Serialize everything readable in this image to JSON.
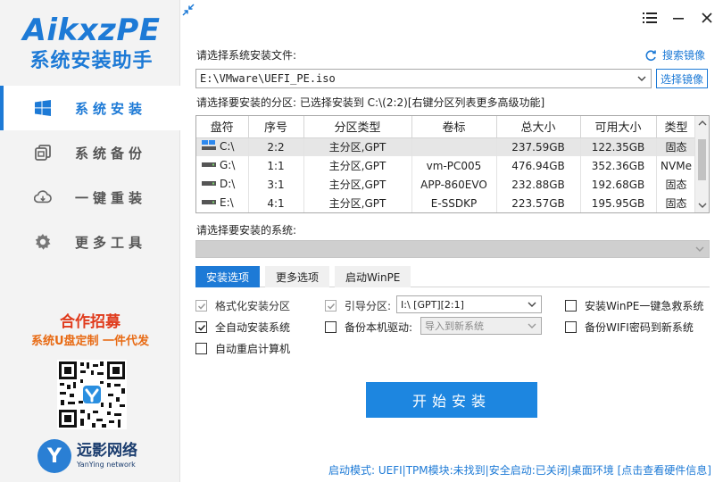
{
  "app": {
    "logo_en": "AikxzPE",
    "logo_cn": "系统安装助手"
  },
  "nav": [
    {
      "label": "系统安装",
      "icon": "windows-icon",
      "active": true
    },
    {
      "label": "系统备份",
      "icon": "backup-icon",
      "active": false
    },
    {
      "label": "一键重装",
      "icon": "cloud-icon",
      "active": false
    },
    {
      "label": "更多工具",
      "icon": "gear-icon",
      "active": false
    }
  ],
  "promo": {
    "title": "合作招募",
    "subtitle": "系统U盘定制 一件代发"
  },
  "brand": {
    "name_cn": "远影网络",
    "name_en": "YanYing network"
  },
  "image_section": {
    "label": "请选择系统安装文件:",
    "path": "E:\\VMware\\UEFI_PE.iso",
    "search_link": "搜索镜像",
    "browse_button": "选择镜像"
  },
  "partition_section": {
    "label": "请选择要安装的分区: 已选择安装到 C:\\(2:2)[右键分区列表更多高级功能]",
    "columns": [
      "盘符",
      "序号",
      "分区类型",
      "卷标",
      "总大小",
      "可用大小",
      "类型"
    ],
    "rows": [
      {
        "drive": "C:\\",
        "index": "2:2",
        "ptype": "主分区,GPT",
        "label": "",
        "total": "237.59GB",
        "free": "122.35GB",
        "kind": "固态",
        "selected": true,
        "icon": "windows-drive-icon"
      },
      {
        "drive": "G:\\",
        "index": "1:1",
        "ptype": "主分区,GPT",
        "label": "vm-PC005",
        "total": "476.94GB",
        "free": "352.36GB",
        "kind": "NVMe",
        "selected": false,
        "icon": "drive-icon"
      },
      {
        "drive": "D:\\",
        "index": "3:1",
        "ptype": "主分区,GPT",
        "label": "APP-860EVO",
        "total": "232.88GB",
        "free": "192.68GB",
        "kind": "固态",
        "selected": false,
        "icon": "drive-icon"
      },
      {
        "drive": "E:\\",
        "index": "4:1",
        "ptype": "主分区,GPT",
        "label": "E-SSDKP",
        "total": "223.57GB",
        "free": "195.95GB",
        "kind": "固态",
        "selected": false,
        "icon": "drive-icon"
      }
    ]
  },
  "system_section": {
    "label": "请选择要安装的系统:"
  },
  "tabs": [
    {
      "label": "安装选项",
      "active": true
    },
    {
      "label": "更多选项",
      "active": false
    },
    {
      "label": "启动WinPE",
      "active": false
    }
  ],
  "options": {
    "format_partition": {
      "label": "格式化安装分区",
      "checked": true,
      "disabled": true
    },
    "auto_install": {
      "label": "全自动安装系统",
      "checked": true,
      "disabled": false
    },
    "auto_restart": {
      "label": "自动重启计算机",
      "checked": false,
      "disabled": false
    },
    "boot_partition": {
      "label": "引导分区:",
      "checked": true,
      "disabled": true,
      "value": "I:\\ [GPT][2:1]"
    },
    "backup_driver": {
      "label": "备份本机驱动:",
      "checked": false,
      "disabled": false,
      "value": "导入到新系统"
    },
    "install_winpe": {
      "label": "安装WinPE一键急救系统",
      "checked": false
    },
    "backup_wifi": {
      "label": "备份WIFI密码到新系统",
      "checked": false
    }
  },
  "start_button": "开始安装",
  "status_bar": "启动模式: UEFI|TPM模块:未找到|安全启动:已关闭|桌面环境 [点击查看硬件信息]",
  "colors": {
    "accent": "#1d7ad6",
    "start_button": "#1d86e0",
    "promo_red": "#e03b1c",
    "promo_orange": "#e86a13"
  }
}
